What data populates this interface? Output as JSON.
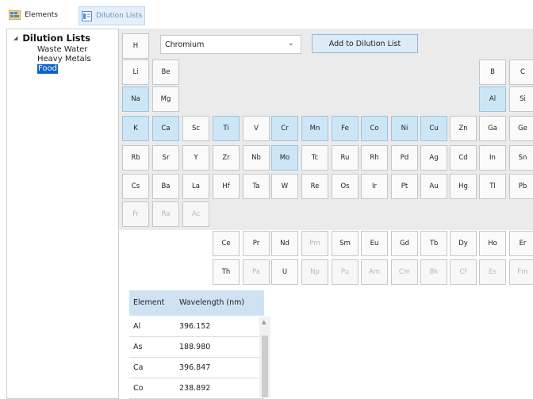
{
  "toolbar": {
    "elements_label": "Elements",
    "dilution_label": "Dilution Lists"
  },
  "tree": {
    "root": "Dilution Lists",
    "children": [
      "Waste Water",
      "Heavy Metals",
      "Food"
    ],
    "selected": "Food"
  },
  "selector": {
    "value": "Chromium"
  },
  "add_button": {
    "label": "Add to Dilution List"
  },
  "elements": {
    "H": "H",
    "Li": "Li",
    "Be": "Be",
    "Na": "Na",
    "Mg": "Mg",
    "B": "B",
    "C": "C",
    "Al": "Al",
    "Si": "Si",
    "K": "K",
    "Ca": "Ca",
    "Sc": "Sc",
    "Ti": "Ti",
    "V": "V",
    "Cr": "Cr",
    "Mn": "Mn",
    "Fe": "Fe",
    "Co": "Co",
    "Ni": "Ni",
    "Cu": "Cu",
    "Zn": "Zn",
    "Ga": "Ga",
    "Ge": "Ge",
    "Rb": "Rb",
    "Sr": "Sr",
    "Y": "Y",
    "Zr": "Zr",
    "Nb": "Nb",
    "Mo": "Mo",
    "Tc": "Tc",
    "Ru": "Ru",
    "Rh": "Rh",
    "Pd": "Pd",
    "Ag": "Ag",
    "Cd": "Cd",
    "In": "In",
    "Sn": "Sn",
    "Cs": "Cs",
    "Ba": "Ba",
    "La": "La",
    "Hf": "Hf",
    "Ta": "Ta",
    "W": "W",
    "Re": "Re",
    "Os": "Os",
    "Ir": "Ir",
    "Pt": "Pt",
    "Au": "Au",
    "Hg": "Hg",
    "Tl": "Tl",
    "Pb": "Pb",
    "Fr": "Fr",
    "Ra": "Ra",
    "Ac": "Ac",
    "Ce": "Ce",
    "Pr": "Pr",
    "Nd": "Nd",
    "Pm": "Pm",
    "Sm": "Sm",
    "Eu": "Eu",
    "Gd": "Gd",
    "Tb": "Tb",
    "Dy": "Dy",
    "Ho": "Ho",
    "Er": "Er",
    "Th": "Th",
    "Pa": "Pa",
    "U": "U",
    "Np": "Np",
    "Pu": "Pu",
    "Am": "Am",
    "Cm": "Cm",
    "Bk": "Bk",
    "Cf": "Cf",
    "Es": "Es",
    "Fm": "Fm"
  },
  "selected_elements": [
    "Na",
    "Al",
    "K",
    "Ca",
    "Ti",
    "Cr",
    "Mn",
    "Fe",
    "Co",
    "Ni",
    "Cu",
    "Mo"
  ],
  "table": {
    "headers": [
      "Element",
      "Wavelength (nm)"
    ],
    "rows": [
      [
        "Al",
        "396.152"
      ],
      [
        "As",
        "188.980"
      ],
      [
        "Ca",
        "396.847"
      ],
      [
        "Co",
        "238.892"
      ]
    ]
  },
  "colors": {
    "selected_cell": "#cde6f6",
    "accent": "#0a64c8",
    "grid_bg": "#ebebeb"
  }
}
